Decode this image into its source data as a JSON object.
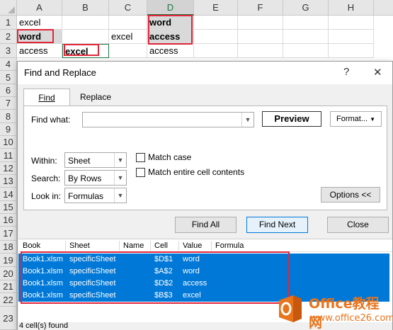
{
  "sheet": {
    "columns": [
      "A",
      "B",
      "C",
      "D",
      "E",
      "F",
      "G",
      "H"
    ],
    "rows": [
      "1",
      "2",
      "3",
      "4",
      "5",
      "6",
      "7",
      "8",
      "9",
      "10",
      "11",
      "12",
      "13",
      "14",
      "15",
      "16",
      "17",
      "18",
      "19",
      "20",
      "21",
      "22",
      "23"
    ],
    "cells": {
      "A1": "excel",
      "A2": "word",
      "A3": "access",
      "B3": "excel",
      "C2": "excel",
      "D1": "word",
      "D2": "access",
      "D3": "access"
    }
  },
  "dialog": {
    "title": "Find and Replace",
    "help_glyph": "?",
    "close_glyph": "✕",
    "tabs": [
      "Find",
      "Replace"
    ],
    "find_what_label": "Find what:",
    "find_what_value": "",
    "preview_label": "Preview",
    "format_label": "Format...",
    "within_label": "Within:",
    "within_value": "Sheet",
    "search_label": "Search:",
    "search_value": "By Rows",
    "lookin_label": "Look in:",
    "lookin_value": "Formulas",
    "match_case_label": "Match case",
    "match_entire_label": "Match entire cell contents",
    "options_label": "Options <<",
    "find_all_label": "Find All",
    "find_next_label": "Find Next",
    "close_label": "Close",
    "result_columns": [
      "Book",
      "Sheet",
      "Name",
      "Cell",
      "Value",
      "Formula"
    ],
    "results": [
      {
        "book": "Book1.xlsm",
        "sheet": "specificSheet",
        "name": "",
        "cell": "$D$1",
        "value": "word",
        "formula": ""
      },
      {
        "book": "Book1.xlsm",
        "sheet": "specificSheet",
        "name": "",
        "cell": "$A$2",
        "value": "word",
        "formula": ""
      },
      {
        "book": "Book1.xlsm",
        "sheet": "specificSheet",
        "name": "",
        "cell": "$D$2",
        "value": "access",
        "formula": ""
      },
      {
        "book": "Book1.xlsm",
        "sheet": "specificSheet",
        "name": "",
        "cell": "$B$3",
        "value": "excel",
        "formula": ""
      }
    ],
    "status": "4 cell(s) found"
  },
  "watermark": {
    "line1": "Office教程网",
    "line2": "www.office26.com"
  },
  "colors": {
    "selection_blue": "#0078d7",
    "highlight_red": "#e0263a",
    "excel_green": "#217346",
    "watermark_orange": "#e8741c"
  }
}
